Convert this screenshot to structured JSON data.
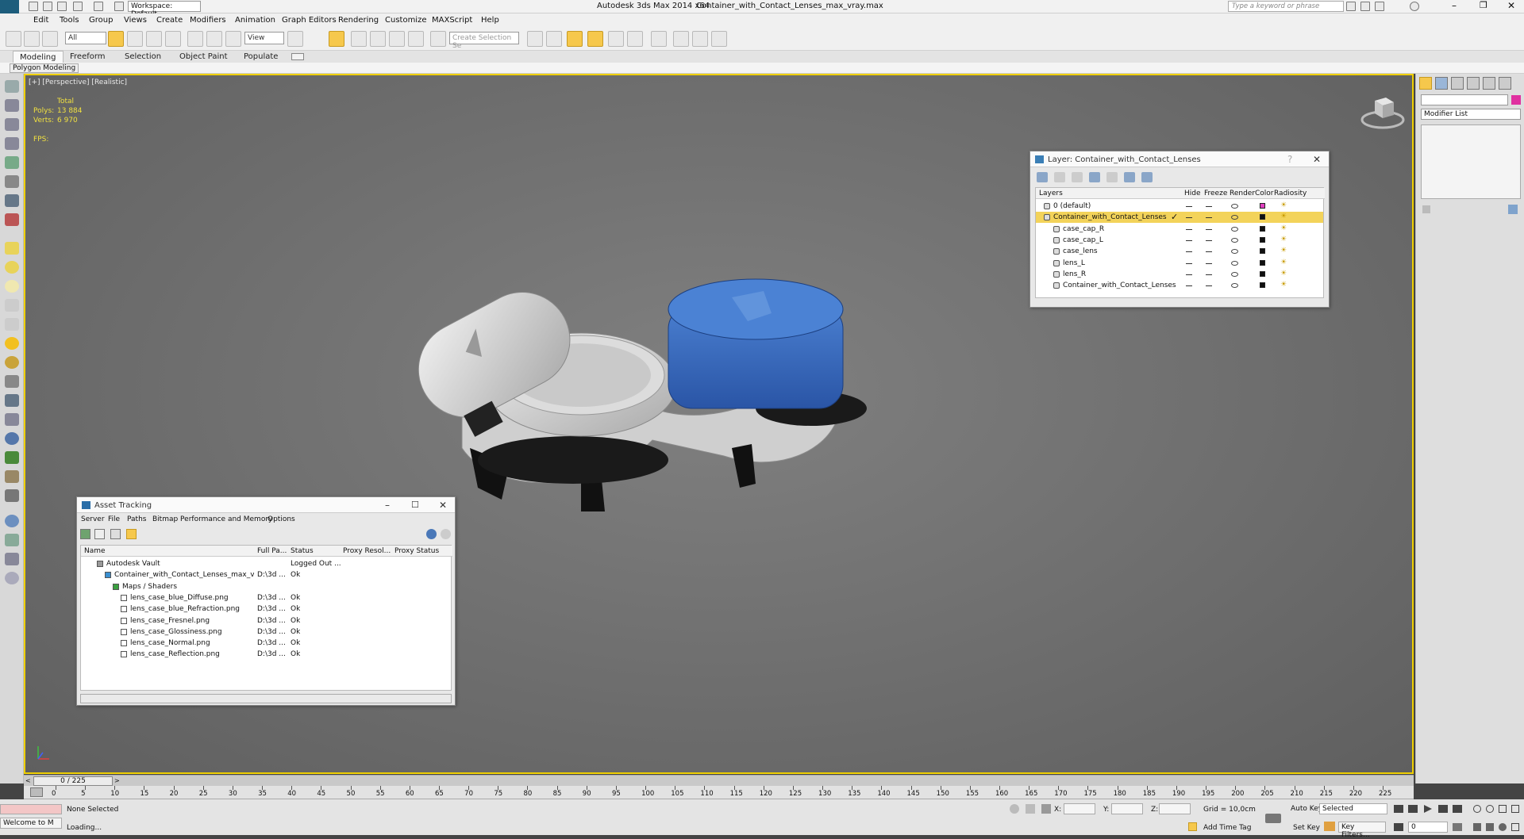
{
  "window": {
    "app_title": "Autodesk 3ds Max  2014 x64",
    "file_title": "Container_with_Contact_Lenses_max_vray.max",
    "workspace": "Workspace: Default",
    "search_placeholder": "Type a keyword or phrase"
  },
  "menu": [
    "Edit",
    "Tools",
    "Group",
    "Views",
    "Create",
    "Modifiers",
    "Animation",
    "Graph Editors",
    "Rendering",
    "Customize",
    "MAXScript",
    "Help"
  ],
  "toolbar": {
    "filter_value": "All",
    "ref_coord_value": "View",
    "selection_set_placeholder": "Create Selection Se"
  },
  "ribbon": {
    "tabs": [
      "Modeling",
      "Freeform",
      "Selection",
      "Object Paint",
      "Populate"
    ],
    "sub_label": "Polygon Modeling"
  },
  "viewport": {
    "label": "[+] [Perspective] [Realistic]",
    "stats_header": "Total",
    "polys_label": "Polys:",
    "polys_value": "13 884",
    "verts_label": "Verts:",
    "verts_value": "6 970",
    "fps_label": "FPS:"
  },
  "layer_dialog": {
    "title": "Layer: Container_with_Contact_Lenses",
    "columns": [
      "Layers",
      "Hide",
      "Freeze",
      "Render",
      "Color",
      "Radiosity"
    ],
    "rows": [
      {
        "name": "0 (default)",
        "color": "#e040c0"
      },
      {
        "name": "Container_with_Contact_Lenses",
        "color": "#111111",
        "selected": true
      },
      {
        "name": "case_cap_R",
        "color": "#111111"
      },
      {
        "name": "case_cap_L",
        "color": "#111111"
      },
      {
        "name": "case_lens",
        "color": "#111111"
      },
      {
        "name": "lens_L",
        "color": "#111111"
      },
      {
        "name": "lens_R",
        "color": "#111111"
      },
      {
        "name": "Container_with_Contact_Lenses",
        "color": "#111111"
      }
    ]
  },
  "asset_dialog": {
    "title": "Asset Tracking",
    "menu": [
      "Server",
      "File",
      "Paths",
      "Bitmap Performance and Memory",
      "Options"
    ],
    "columns": [
      "Name",
      "Full Pa...",
      "Status",
      "Proxy Resol...",
      "Proxy Status"
    ],
    "rows": [
      {
        "name": "Autodesk Vault",
        "path": "",
        "status": "Logged Out ...",
        "indent": 1
      },
      {
        "name": "Container_with_Contact_Lenses_max_vray....",
        "path": "D:\\3d ...",
        "status": "Ok",
        "indent": 2
      },
      {
        "name": "Maps / Shaders",
        "path": "",
        "status": "",
        "indent": 3
      },
      {
        "name": "lens_case_blue_Diffuse.png",
        "path": "D:\\3d ...",
        "status": "Ok",
        "indent": 4
      },
      {
        "name": "lens_case_blue_Refraction.png",
        "path": "D:\\3d ...",
        "status": "Ok",
        "indent": 4
      },
      {
        "name": "lens_case_Fresnel.png",
        "path": "D:\\3d ...",
        "status": "Ok",
        "indent": 4
      },
      {
        "name": "lens_case_Glossiness.png",
        "path": "D:\\3d ...",
        "status": "Ok",
        "indent": 4
      },
      {
        "name": "lens_case_Normal.png",
        "path": "D:\\3d ...",
        "status": "Ok",
        "indent": 4
      },
      {
        "name": "lens_case_Reflection.png",
        "path": "D:\\3d ...",
        "status": "Ok",
        "indent": 4
      }
    ]
  },
  "right_panel": {
    "modifier_list": "Modifier List"
  },
  "timeline": {
    "frame_counter": "0 / 225",
    "ticks": [
      "0",
      "5",
      "10",
      "15",
      "20",
      "25",
      "30",
      "35",
      "40",
      "45",
      "50",
      "55",
      "60",
      "65",
      "70",
      "75",
      "80",
      "85",
      "90",
      "95",
      "100",
      "105",
      "110",
      "115",
      "120",
      "125",
      "130",
      "135",
      "140",
      "145",
      "150",
      "155",
      "160",
      "165",
      "170",
      "175",
      "180",
      "185",
      "190",
      "195",
      "200",
      "205",
      "210",
      "215",
      "220",
      "225"
    ]
  },
  "status": {
    "welcome": "Welcome to M",
    "selection": "None Selected",
    "loading": "Loading...",
    "x_label": "X:",
    "y_label": "Y:",
    "z_label": "Z:",
    "grid": "Grid = 10,0cm",
    "add_time_tag": "Add Time Tag",
    "auto_key": "Auto Key",
    "set_key": "Set Key",
    "selected_value": "Selected",
    "key_filters": "Key Filters...",
    "current_frame": "0"
  }
}
